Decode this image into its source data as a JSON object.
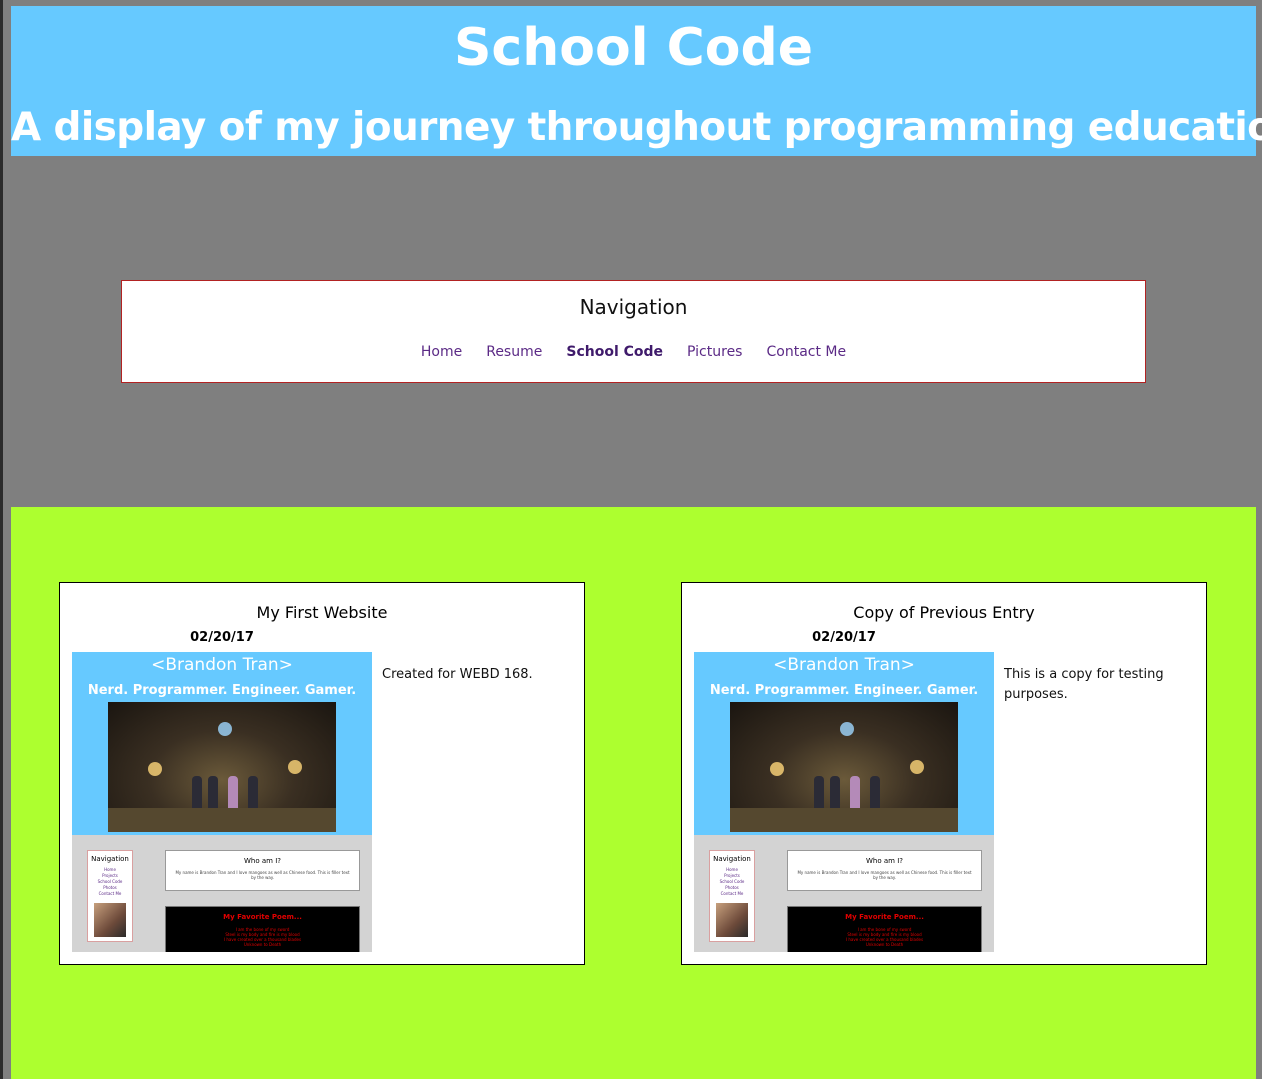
{
  "header": {
    "title": "School Code",
    "subtitle": "A display of my journey throughout programming education."
  },
  "navigation": {
    "title": "Navigation",
    "links": [
      "Home",
      "Resume",
      "School Code",
      "Pictures",
      "Contact Me"
    ],
    "active": "School Code"
  },
  "entries": [
    {
      "title": "My First Website",
      "date": "02/20/17",
      "description": "Created for WEBD 168."
    },
    {
      "title": "Copy of Previous Entry",
      "date": "02/20/17",
      "description": "This is a copy for testing purposes."
    }
  ],
  "thumbnail": {
    "name": "<Brandon Tran>",
    "tagline": "Nerd. Programmer. Engineer. Gamer.",
    "nav_title": "Navigation",
    "nav_links": [
      "Home",
      "Projects",
      "School Code",
      "Photos",
      "Contact Me"
    ],
    "who_title": "Who am I?",
    "who_text": "My name is Brandon Tran and I love mangoes as well as Chinese food. This is filler text by the way.",
    "poem_title": "My Favorite Poem...",
    "poem_lines": [
      "I am the bone of my sword",
      "Steel is my body and fire is my blood",
      "I have created over a thousand blades",
      "Unknown to Death"
    ]
  },
  "colors": {
    "header_bg": "#66c9ff",
    "page_bg": "#7f7f7f",
    "content_bg": "#adff2f",
    "nav_border": "#b22222",
    "link": "#5b2a86"
  }
}
